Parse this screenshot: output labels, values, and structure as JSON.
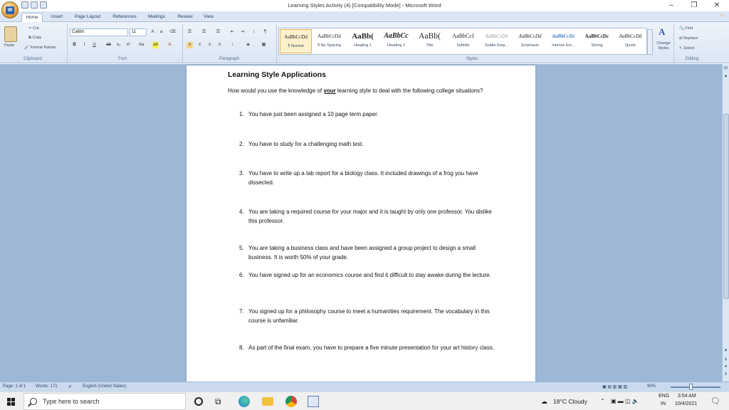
{
  "window": {
    "title": "Learning Styles Activity (4) [Compatibility Mode] - Microsoft Word",
    "minimize": "–",
    "maximize": "❐",
    "close": "✕"
  },
  "app": {
    "orb_letter": "W"
  },
  "tabs": [
    "Home",
    "Insert",
    "Page Layout",
    "References",
    "Mailings",
    "Review",
    "View"
  ],
  "clipboard": {
    "paste": "Paste",
    "cut": "Cut",
    "copy": "Copy",
    "format_painter": "Format Painter",
    "label": "Clipboard"
  },
  "font": {
    "name": "Calibri",
    "size": "11",
    "label": "Font"
  },
  "paragraph": {
    "label": "Paragraph"
  },
  "styles": {
    "label": "Styles",
    "items": [
      {
        "sample": "AaBbCcDd",
        "name": "¶ Normal"
      },
      {
        "sample": "AaBbCcDd",
        "name": "¶ No Spacing"
      },
      {
        "sample": "AaBb(",
        "name": "Heading 1"
      },
      {
        "sample": "AaBbCc",
        "name": "Heading 2"
      },
      {
        "sample": "AaBb(",
        "name": "Title"
      },
      {
        "sample": "AaBbCcI",
        "name": "Subtitle"
      },
      {
        "sample": "AaBbCcDd",
        "name": "Subtle Emp..."
      },
      {
        "sample": "AaBbCcDd",
        "name": "Emphasis"
      },
      {
        "sample": "AaBbCcDc",
        "name": "Intense Em..."
      },
      {
        "sample": "AaBbCcDc",
        "name": "Strong"
      },
      {
        "sample": "AaBbCcDd",
        "name": "Quote"
      }
    ],
    "change_styles": "Change Styles"
  },
  "editing": {
    "find": "Find",
    "replace": "Replace",
    "select": "Select",
    "label": "Editing"
  },
  "document": {
    "title": "Learning Style Applications",
    "intro_before": "How would you use the knowledge of ",
    "intro_emph": "your",
    "intro_after": " learning style to deal with the following college situations?",
    "questions": [
      {
        "num": "1.",
        "text": "You have just been assigned a 10 page term paper."
      },
      {
        "num": "2.",
        "text": "You have to study for a challenging math test."
      },
      {
        "num": "3.",
        "text": "You have to write up a lab report for a biology class.  It included drawings of a frog you have dissected."
      },
      {
        "num": "4.",
        "text": "You are taking a required course for your major and it is taught by only one professor.  You dislike this professor."
      },
      {
        "num": "5.",
        "text": "You are taking a business class and have been assigned a group project to design a small business.  It is worth 50% of your grade."
      },
      {
        "num": "6.",
        "text": " You have signed up for an economics course and find it difficult to stay awake during the lecture."
      },
      {
        "num": "7.",
        "text": " You signed up for a philosophy course to meet a humanities requirement.  The vocabulary in this course is unfamiliar."
      },
      {
        "num": "8.",
        "text": "As part of the final exam, you have to prepare a five minute presentation for your art history class."
      }
    ]
  },
  "status": {
    "page": "Page: 1 of 1",
    "words": "Words: 171",
    "language": "English (United States)",
    "zoom": "90%"
  },
  "taskbar": {
    "search_placeholder": "Type here to search",
    "weather": "18°C  Cloudy",
    "lang_top": "ENG",
    "lang_bottom": "IN",
    "time": "3:54 AM",
    "date": "10/4/2021"
  },
  "colors": {
    "ribbon_bg": "#dbe6f4",
    "doc_bg": "#9fb7d6",
    "taskbar_bg": "#f0f0f0"
  }
}
